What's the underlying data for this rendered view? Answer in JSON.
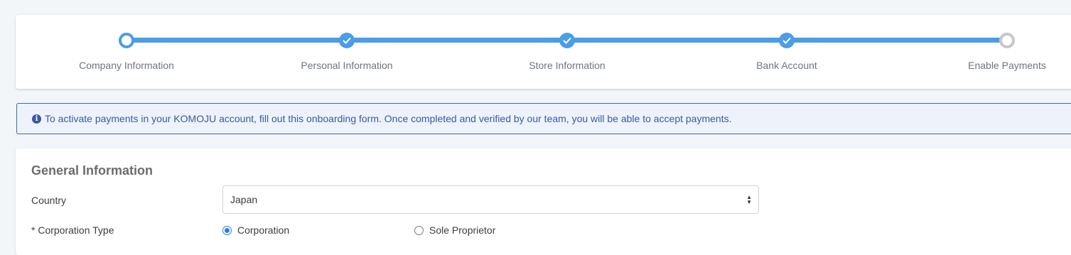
{
  "stepper": {
    "steps": [
      {
        "label": "Company Information",
        "state": "active"
      },
      {
        "label": "Personal Information",
        "state": "done"
      },
      {
        "label": "Store Information",
        "state": "done"
      },
      {
        "label": "Bank Account",
        "state": "done"
      },
      {
        "label": "Enable Payments",
        "state": "pending"
      }
    ],
    "accent_color": "#4a9de6"
  },
  "notice": {
    "icon": "info-icon",
    "text": "To activate payments in your KOMOJU account, fill out this onboarding form. Once completed and verified by our team, you will be able to accept payments."
  },
  "form": {
    "section_title": "General Information",
    "country": {
      "label": "Country",
      "value": "Japan"
    },
    "corporation_type": {
      "label": "* Corporation Type",
      "options": [
        {
          "label": "Corporation",
          "checked": true
        },
        {
          "label": "Sole Proprietor",
          "checked": false
        }
      ]
    }
  }
}
